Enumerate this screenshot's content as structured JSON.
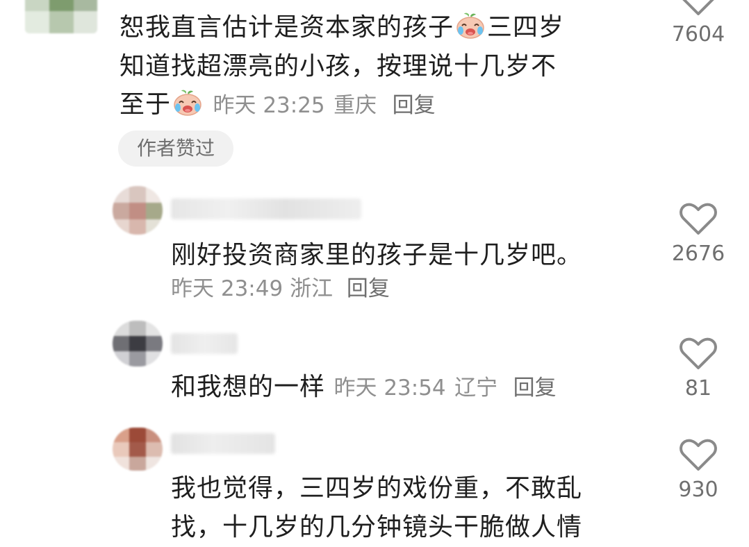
{
  "comments": [
    {
      "text_lines": [
        "恕我直言估计是资本家的孩子",
        "三四岁",
        "知道找超漂亮的小孩，按理说十几岁不",
        "至于"
      ],
      "emoji": "crying-laughing-peach-emoji",
      "time": "昨天 23:25",
      "location": "重庆",
      "reply_label": "回复",
      "badge": "作者赞过",
      "likes": "7604"
    },
    {
      "text": "刚好投资商家里的孩子是十几岁吧。",
      "time": "昨天 23:49",
      "location": "浙江",
      "reply_label": "回复",
      "likes": "2676"
    },
    {
      "text": "和我想的一样",
      "time": "昨天 23:54",
      "location": "辽宁",
      "reply_label": "回复",
      "likes": "81"
    },
    {
      "text_lines": [
        "我也觉得，三四岁的戏份重，不敢乱",
        "找，十几岁的几分钟镜头干脆做人情"
      ],
      "likes": "930"
    }
  ],
  "colors": {
    "text": "#1e1e1e",
    "meta": "#8f8f8f",
    "badge_bg": "#f1f1f1",
    "heart_stroke": "#8a8a8a"
  }
}
